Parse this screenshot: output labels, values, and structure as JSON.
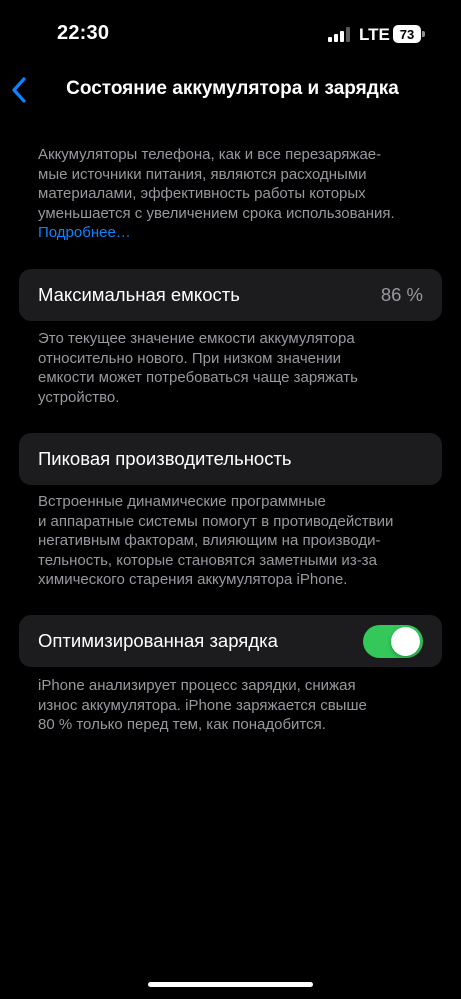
{
  "status_bar": {
    "time": "22:30",
    "network": "LTE",
    "battery_level": "73",
    "signal_icon": "cellular-signal-icon"
  },
  "nav": {
    "back_icon": "chevron-left-icon",
    "title": "Состояние аккумулятора и зарядка"
  },
  "intro": {
    "text": "Аккумуляторы телефона, как и все перезаряжае­мые источники питания, являются расходными материалами, эффективность работы которых уменьшается с увеличением срока использования.",
    "lines": [
      "Аккумуляторы телефона, как и все перезаряжае-",
      "мые источники питания, являются расходными",
      "материалами, эффективность работы которых",
      "уменьшается с увеличением срока использования."
    ],
    "link": "Подробнее…"
  },
  "max_capacity": {
    "label": "Максимальная емкость",
    "value": "86 %",
    "footnote": [
      "Это текущее значение емкости аккумулятора",
      "относительно нового. При низком значении",
      "емкости может потребоваться чаще заряжать",
      "устройство."
    ]
  },
  "peak_performance": {
    "label": "Пиковая производительность",
    "footnote": [
      "Встроенные динамические программные",
      "и аппаратные системы помогут в противодействии",
      "негативным факторам, влияющим на производи-",
      "тельность, которые становятся заметными из-за",
      "химического старения аккумулятора iPhone."
    ]
  },
  "optimized_charging": {
    "label": "Оптимизированная зарядка",
    "enabled": true,
    "footnote": [
      "iPhone анализирует процесс зарядки, снижая",
      "износ аккумулятора. iPhone заряжается свыше",
      "80 % только перед тем, как понадобится."
    ]
  },
  "colors": {
    "background": "#000000",
    "cell": "#1c1c1e",
    "secondary_text": "#98989f",
    "link": "#0a84ff",
    "toggle_on": "#34c759"
  }
}
